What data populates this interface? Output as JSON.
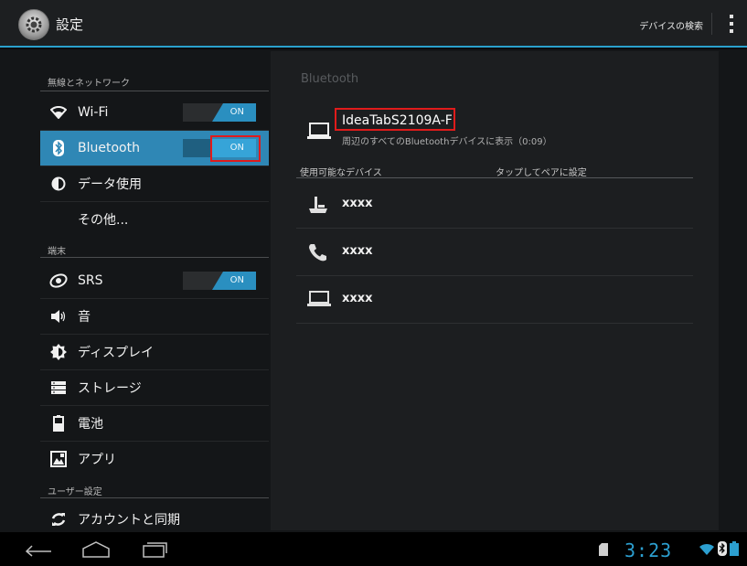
{
  "header": {
    "title": "設定",
    "search_devices": "デバイスの検索"
  },
  "sidebar": {
    "sections": [
      {
        "label": "無線とネットワーク"
      },
      {
        "label": "端末"
      },
      {
        "label": "ユーザー設定"
      }
    ],
    "items": [
      {
        "label": "Wi-Fi",
        "icon": "wifi-icon",
        "toggle": "ON"
      },
      {
        "label": "Bluetooth",
        "icon": "bluetooth-icon",
        "toggle": "ON",
        "active": true
      },
      {
        "label": "データ使用",
        "icon": "data-usage-icon"
      },
      {
        "label": "その他..."
      },
      {
        "label": "SRS",
        "icon": "srs-icon",
        "toggle": "ON"
      },
      {
        "label": "音",
        "icon": "speaker-icon"
      },
      {
        "label": "ディスプレイ",
        "icon": "display-brightness-icon"
      },
      {
        "label": "ストレージ",
        "icon": "storage-icon"
      },
      {
        "label": "電池",
        "icon": "battery-icon"
      },
      {
        "label": "アプリ",
        "icon": "apps-icon"
      },
      {
        "label": "アカウントと同期",
        "icon": "sync-icon"
      }
    ]
  },
  "bluetooth": {
    "heading": "Bluetooth",
    "device_name": "IdeaTabS2109A-F",
    "device_visibility": "周辺のすべてのBluetoothデバイスに表示（0:09）",
    "available_label": "使用可能なデバイス",
    "tap_to_pair": "タップしてペアに設定",
    "devices": [
      {
        "name": "xxxx",
        "icon": "headset-device-icon"
      },
      {
        "name": "xxxx",
        "icon": "phone-icon"
      },
      {
        "name": "xxxx",
        "icon": "laptop-icon"
      }
    ]
  },
  "status": {
    "time": "3:23"
  },
  "colors": {
    "accent": "#2aa0cc",
    "highlight_box": "#e01b1b",
    "active_item": "#2f87b5"
  }
}
